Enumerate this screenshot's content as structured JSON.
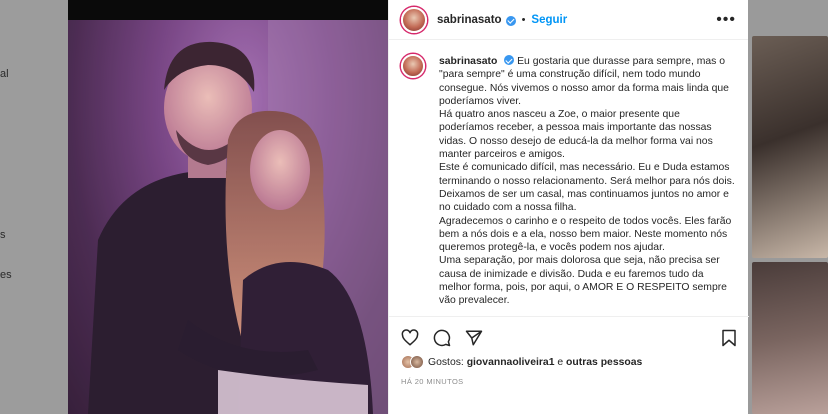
{
  "background": {
    "left_fragments": [
      "al",
      "s",
      "es"
    ]
  },
  "post": {
    "username": "sabrinasato",
    "follow_label": "Seguir",
    "dot": "•",
    "more_label": "•••",
    "caption_username": "sabrinasato",
    "caption_paragraphs": [
      "Eu gostaria que durasse para sempre, mas o \"para sempre\" é uma construção difícil, nem todo mundo consegue. Nós vivemos o nosso amor da forma mais linda que poderíamos viver.",
      "Há quatro anos nasceu a Zoe, o maior presente que poderíamos receber, a pessoa mais importante das nossas vidas. O nosso desejo de educá-la da melhor forma vai nos manter parceiros e amigos.",
      "Este é comunicado difícil, mas necessário. Eu e Duda estamos terminando o nosso relacionamento. Será melhor para nós dois. Deixamos de ser um casal, mas continuamos juntos no amor e no cuidado com a nossa filha.",
      "Agradecemos o carinho e o respeito de todos vocês. Eles farão bem a nós dois e a ela, nosso bem maior. Neste momento nós queremos protegê-la, e vocês podem nos ajudar.",
      "Uma separação, por mais dolorosa que seja, não precisa ser causa de inimizade e divisão. Duda e eu faremos tudo da melhor forma, pois, por aqui, o AMOR E O RESPEITO sempre vão prevalecer."
    ],
    "likes_prefix": "Gostos:",
    "likes_user": "giovannaoliveira1",
    "likes_connector": "e",
    "likes_others": "outras pessoas",
    "timestamp": "HÁ 20 MINUTOS"
  },
  "colors": {
    "link_blue": "#0095f6",
    "verified_blue": "#3897f0",
    "text": "#262626",
    "muted": "#8e8e8e"
  }
}
